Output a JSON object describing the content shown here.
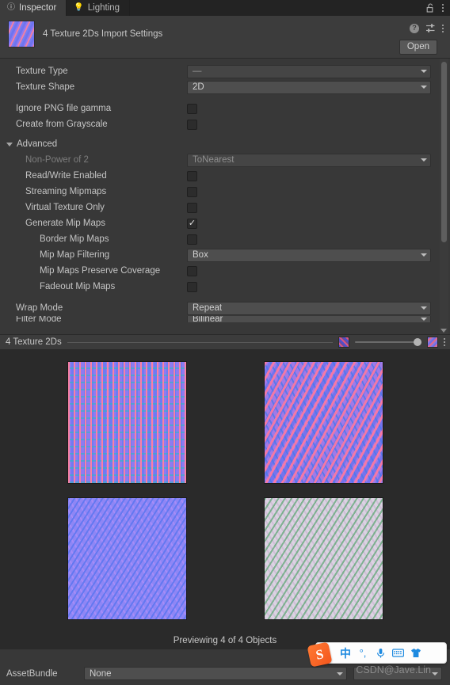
{
  "tabbar": {
    "tabs": [
      {
        "label": "Inspector",
        "icon": "info-icon",
        "active": true
      },
      {
        "label": "Lighting",
        "icon": "bulb-icon",
        "active": false
      }
    ],
    "lock_icon": "unlocked-padlock-icon",
    "menu_icon": "kebab-menu-icon"
  },
  "object_header": {
    "title": "4 Texture 2Ds Import Settings",
    "thumbnail_icon": "texture-thumbnail",
    "help_icon": "help-icon",
    "preset_icon": "preset-sliders-icon",
    "menu_icon": "kebab-menu-icon",
    "open_label": "Open"
  },
  "settings": {
    "rows": [
      {
        "kind": "dropdown",
        "label": "Texture Type",
        "value": "—",
        "dim_value": true,
        "dim_label": false,
        "indent": 0
      },
      {
        "kind": "dropdown",
        "label": "Texture Shape",
        "value": "2D",
        "dim_value": false,
        "dim_label": false,
        "indent": 0
      },
      {
        "kind": "checkbox",
        "label": "Ignore PNG file gamma",
        "checked": false,
        "indent": 0,
        "spaced": true
      },
      {
        "kind": "checkbox",
        "label": "Create from Grayscale",
        "checked": false,
        "indent": 0
      }
    ],
    "advanced": {
      "label": "Advanced",
      "expanded": true,
      "rows": [
        {
          "kind": "dropdown",
          "label": "Non-Power of 2",
          "value": "ToNearest",
          "dim_value": true,
          "dim_label": true,
          "indent": 1
        },
        {
          "kind": "checkbox",
          "label": "Read/Write Enabled",
          "checked": false,
          "indent": 1
        },
        {
          "kind": "checkbox",
          "label": "Streaming Mipmaps",
          "checked": false,
          "indent": 1
        },
        {
          "kind": "checkbox",
          "label": "Virtual Texture Only",
          "checked": false,
          "indent": 1
        },
        {
          "kind": "checkbox",
          "label": "Generate Mip Maps",
          "checked": true,
          "indent": 1
        },
        {
          "kind": "checkbox",
          "label": "Border Mip Maps",
          "checked": false,
          "indent": 2
        },
        {
          "kind": "dropdown",
          "label": "Mip Map Filtering",
          "value": "Box",
          "dim_value": false,
          "dim_label": false,
          "indent": 2
        },
        {
          "kind": "checkbox",
          "label": "Mip Maps Preserve Coverage",
          "checked": false,
          "indent": 2
        },
        {
          "kind": "checkbox",
          "label": "Fadeout Mip Maps",
          "checked": false,
          "indent": 2
        }
      ]
    },
    "tail_rows": [
      {
        "kind": "dropdown",
        "label": "Wrap Mode",
        "value": "Repeat",
        "dim_value": false,
        "dim_label": false,
        "indent": 0,
        "spaced": true
      },
      {
        "kind": "dropdown",
        "label": "Filter Mode",
        "value": "Bilinear",
        "dim_value": false,
        "dim_label": false,
        "indent": 0,
        "clipped": true
      }
    ],
    "scrollbar": {
      "name": "settings-scrollbar"
    }
  },
  "preview": {
    "title": "4 Texture 2Ds",
    "left_chip_icon": "texture-swatch-icon",
    "right_chip_icon": "texture-filter-icon",
    "slider_value": 100,
    "menu_icon": "kebab-menu-icon",
    "tiles": [
      {
        "name": "texture-preview-1"
      },
      {
        "name": "texture-preview-2"
      },
      {
        "name": "texture-preview-3"
      },
      {
        "name": "texture-preview-4"
      }
    ],
    "status": "Previewing 4 of 4 Objects"
  },
  "bottom": {
    "assetbundle_label": "AssetBundle",
    "assetbundle_value": "None",
    "assetbundle_variant": ""
  },
  "watermark": "CSDN@Jave.Lin",
  "ime": {
    "logo": "S",
    "items": [
      {
        "icon": "chinese-mode-icon",
        "glyph": "中"
      },
      {
        "icon": "punctuation-icon",
        "glyph": "°,"
      },
      {
        "icon": "microphone-icon",
        "glyph": "🎙"
      },
      {
        "icon": "keyboard-icon",
        "glyph": "⌨"
      },
      {
        "icon": "skin-shirt-icon",
        "glyph": "👕"
      }
    ],
    "grid_icon": "app-grid-icon"
  },
  "colors": {
    "window_bg": "#383838",
    "tabbar_bg": "#232323",
    "panel_bg": "#3c3c3c",
    "preview_bg": "#2a2a2a",
    "text": "#c4c4c4",
    "text_dim": "#7d7d7d",
    "field_bg": "#4e4e4e",
    "ime_accent": "#1e8ae0",
    "ime_logo": "#f4561d"
  }
}
